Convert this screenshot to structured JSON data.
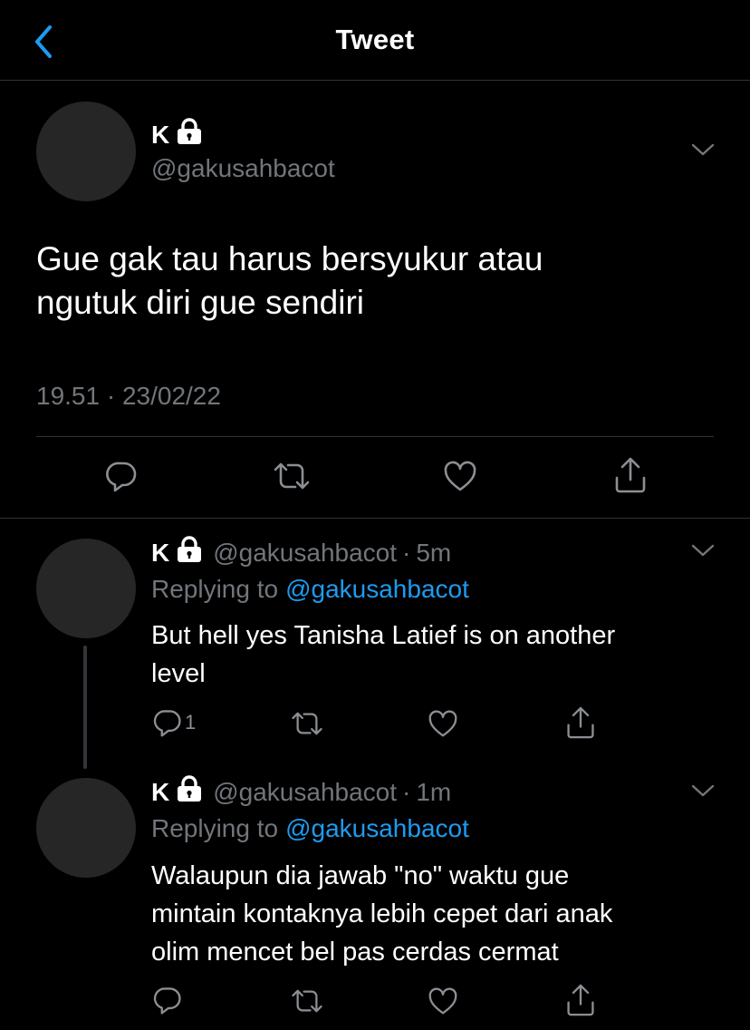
{
  "header": {
    "title": "Tweet"
  },
  "tweet": {
    "name": "K",
    "handle": "@gakusahbacot",
    "text_lines": [
      "Gue gak tau harus bersyukur atau",
      "ngutuk diri gue sendiri"
    ],
    "timestamp": "19.51 · 23/02/22"
  },
  "replies": [
    {
      "name": "K",
      "handle": "@gakusahbacot",
      "dot": "·",
      "time": "5m",
      "replying_prefix": "Replying to",
      "replying_to": "@gakusahbacot",
      "text_lines": [
        "But hell yes Tanisha Latief is on another",
        "level"
      ],
      "reply_count": "1"
    },
    {
      "name": "K",
      "handle": "@gakusahbacot",
      "dot": "·",
      "time": "1m",
      "replying_prefix": "Replying to",
      "replying_to": "@gakusahbacot",
      "text_lines": [
        "Walaupun dia jawab \"no\" waktu gue",
        "mintain kontaknya lebih cepet dari anak",
        "olim mencet bel pas cerdas cermat"
      ],
      "reply_count": ""
    }
  ],
  "icons": {
    "back": "chevron-left-icon",
    "lock": "lock-icon",
    "more": "chevron-down-icon",
    "reply": "reply-icon",
    "retweet": "retweet-icon",
    "like": "like-icon",
    "share": "share-icon"
  },
  "colors": {
    "background": "#000000",
    "accent": "#1d9bf0",
    "muted": "#71767b",
    "divider": "#2f3336"
  }
}
